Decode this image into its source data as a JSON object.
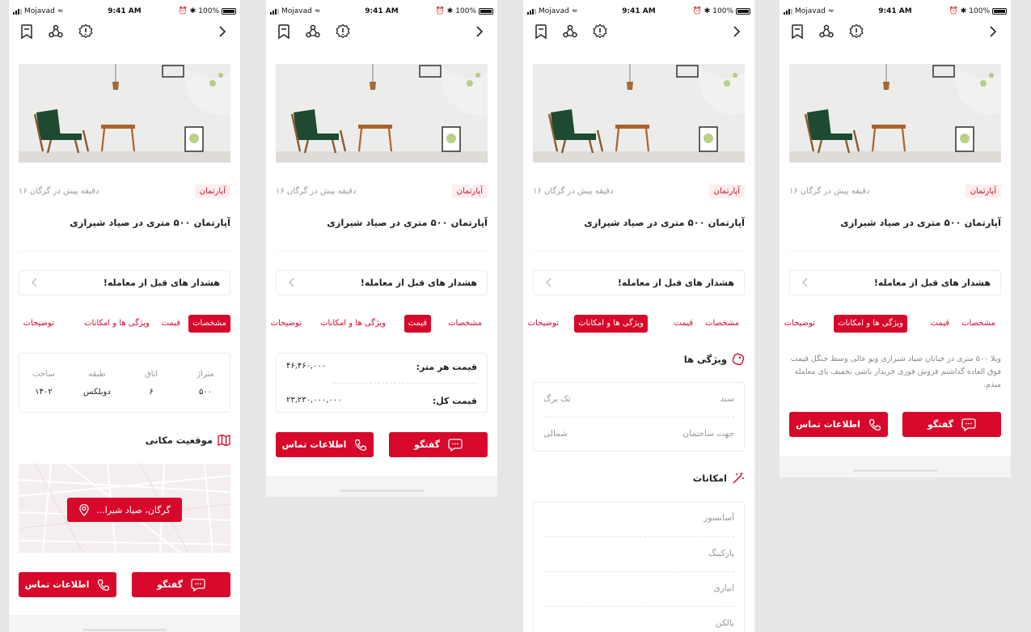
{
  "status": {
    "carrier": "Mojavad",
    "time": "9:41 AM",
    "battery": "100%"
  },
  "listing": {
    "category": "آپارتمان",
    "time_location": "۱۶ دقیقه پیش در گرگان",
    "title": "آپارتمان ۵۰۰ متری در صیاد شیرازی",
    "warning": "هشدار های قبل از معامله!"
  },
  "tabs": [
    "مشخصات",
    "قیمت",
    "ویژگی ها و امکانات",
    "توضیحات"
  ],
  "specs": {
    "headers": [
      "متراژ",
      "اتاق",
      "طبقه",
      "ساخت"
    ],
    "values": [
      "۵۰۰",
      "۶",
      "دوبلکس",
      "۱۴۰۲"
    ]
  },
  "location": {
    "title": "موقعیت مکانی",
    "pill": "گرگان، صیاد شیرا..."
  },
  "buttons": {
    "chat": "گفتگو",
    "contact": "اطلاعات تماس"
  },
  "price": {
    "per_meter_label": "قیمت هر متر:",
    "per_meter_value": "۴۶,۴۶۰,۰۰۰",
    "total_label": "قیمت کل:",
    "total_value": "۲۳,۲۳۰,۰۰۰,۰۰۰"
  },
  "features": {
    "title": "ویژگی ها",
    "items": [
      {
        "label": "سند",
        "value": "تک برگ"
      },
      {
        "label": "جهت ساختمان",
        "value": "شمالی"
      }
    ]
  },
  "amenities": {
    "title": "امکانات",
    "items": [
      "آسانسور",
      "پارکینگ",
      "انباری",
      "بالکن"
    ]
  },
  "description": "ویلا ۵۰۰ متری در خیابان صیاد شیرازی ویو عالی وسط جنگل قیمت فوق العاده  گذاشتم فروش فوری  خریدار باشی تخفیف پای معامله میدم.",
  "colors": {
    "accent": "#d7082a",
    "accent_light": "#fdeef0"
  }
}
